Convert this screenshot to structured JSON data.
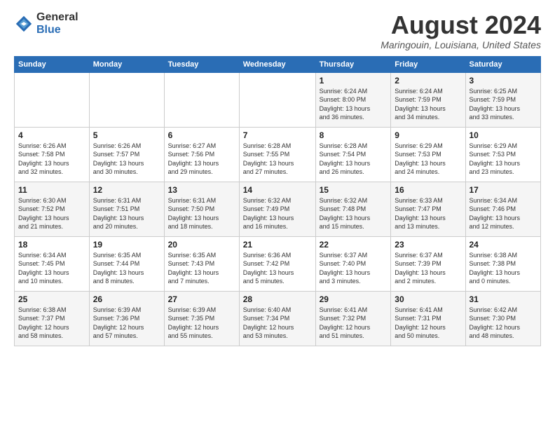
{
  "header": {
    "logo": {
      "general": "General",
      "blue": "Blue"
    },
    "title": "August 2024",
    "location": "Maringouin, Louisiana, United States"
  },
  "days_of_week": [
    "Sunday",
    "Monday",
    "Tuesday",
    "Wednesday",
    "Thursday",
    "Friday",
    "Saturday"
  ],
  "weeks": [
    [
      {
        "day": "",
        "info": ""
      },
      {
        "day": "",
        "info": ""
      },
      {
        "day": "",
        "info": ""
      },
      {
        "day": "",
        "info": ""
      },
      {
        "day": "1",
        "info": "Sunrise: 6:24 AM\nSunset: 8:00 PM\nDaylight: 13 hours\nand 36 minutes."
      },
      {
        "day": "2",
        "info": "Sunrise: 6:24 AM\nSunset: 7:59 PM\nDaylight: 13 hours\nand 34 minutes."
      },
      {
        "day": "3",
        "info": "Sunrise: 6:25 AM\nSunset: 7:59 PM\nDaylight: 13 hours\nand 33 minutes."
      }
    ],
    [
      {
        "day": "4",
        "info": "Sunrise: 6:26 AM\nSunset: 7:58 PM\nDaylight: 13 hours\nand 32 minutes."
      },
      {
        "day": "5",
        "info": "Sunrise: 6:26 AM\nSunset: 7:57 PM\nDaylight: 13 hours\nand 30 minutes."
      },
      {
        "day": "6",
        "info": "Sunrise: 6:27 AM\nSunset: 7:56 PM\nDaylight: 13 hours\nand 29 minutes."
      },
      {
        "day": "7",
        "info": "Sunrise: 6:28 AM\nSunset: 7:55 PM\nDaylight: 13 hours\nand 27 minutes."
      },
      {
        "day": "8",
        "info": "Sunrise: 6:28 AM\nSunset: 7:54 PM\nDaylight: 13 hours\nand 26 minutes."
      },
      {
        "day": "9",
        "info": "Sunrise: 6:29 AM\nSunset: 7:53 PM\nDaylight: 13 hours\nand 24 minutes."
      },
      {
        "day": "10",
        "info": "Sunrise: 6:29 AM\nSunset: 7:53 PM\nDaylight: 13 hours\nand 23 minutes."
      }
    ],
    [
      {
        "day": "11",
        "info": "Sunrise: 6:30 AM\nSunset: 7:52 PM\nDaylight: 13 hours\nand 21 minutes."
      },
      {
        "day": "12",
        "info": "Sunrise: 6:31 AM\nSunset: 7:51 PM\nDaylight: 13 hours\nand 20 minutes."
      },
      {
        "day": "13",
        "info": "Sunrise: 6:31 AM\nSunset: 7:50 PM\nDaylight: 13 hours\nand 18 minutes."
      },
      {
        "day": "14",
        "info": "Sunrise: 6:32 AM\nSunset: 7:49 PM\nDaylight: 13 hours\nand 16 minutes."
      },
      {
        "day": "15",
        "info": "Sunrise: 6:32 AM\nSunset: 7:48 PM\nDaylight: 13 hours\nand 15 minutes."
      },
      {
        "day": "16",
        "info": "Sunrise: 6:33 AM\nSunset: 7:47 PM\nDaylight: 13 hours\nand 13 minutes."
      },
      {
        "day": "17",
        "info": "Sunrise: 6:34 AM\nSunset: 7:46 PM\nDaylight: 13 hours\nand 12 minutes."
      }
    ],
    [
      {
        "day": "18",
        "info": "Sunrise: 6:34 AM\nSunset: 7:45 PM\nDaylight: 13 hours\nand 10 minutes."
      },
      {
        "day": "19",
        "info": "Sunrise: 6:35 AM\nSunset: 7:44 PM\nDaylight: 13 hours\nand 8 minutes."
      },
      {
        "day": "20",
        "info": "Sunrise: 6:35 AM\nSunset: 7:43 PM\nDaylight: 13 hours\nand 7 minutes."
      },
      {
        "day": "21",
        "info": "Sunrise: 6:36 AM\nSunset: 7:42 PM\nDaylight: 13 hours\nand 5 minutes."
      },
      {
        "day": "22",
        "info": "Sunrise: 6:37 AM\nSunset: 7:40 PM\nDaylight: 13 hours\nand 3 minutes."
      },
      {
        "day": "23",
        "info": "Sunrise: 6:37 AM\nSunset: 7:39 PM\nDaylight: 13 hours\nand 2 minutes."
      },
      {
        "day": "24",
        "info": "Sunrise: 6:38 AM\nSunset: 7:38 PM\nDaylight: 13 hours\nand 0 minutes."
      }
    ],
    [
      {
        "day": "25",
        "info": "Sunrise: 6:38 AM\nSunset: 7:37 PM\nDaylight: 12 hours\nand 58 minutes."
      },
      {
        "day": "26",
        "info": "Sunrise: 6:39 AM\nSunset: 7:36 PM\nDaylight: 12 hours\nand 57 minutes."
      },
      {
        "day": "27",
        "info": "Sunrise: 6:39 AM\nSunset: 7:35 PM\nDaylight: 12 hours\nand 55 minutes."
      },
      {
        "day": "28",
        "info": "Sunrise: 6:40 AM\nSunset: 7:34 PM\nDaylight: 12 hours\nand 53 minutes."
      },
      {
        "day": "29",
        "info": "Sunrise: 6:41 AM\nSunset: 7:32 PM\nDaylight: 12 hours\nand 51 minutes."
      },
      {
        "day": "30",
        "info": "Sunrise: 6:41 AM\nSunset: 7:31 PM\nDaylight: 12 hours\nand 50 minutes."
      },
      {
        "day": "31",
        "info": "Sunrise: 6:42 AM\nSunset: 7:30 PM\nDaylight: 12 hours\nand 48 minutes."
      }
    ]
  ]
}
